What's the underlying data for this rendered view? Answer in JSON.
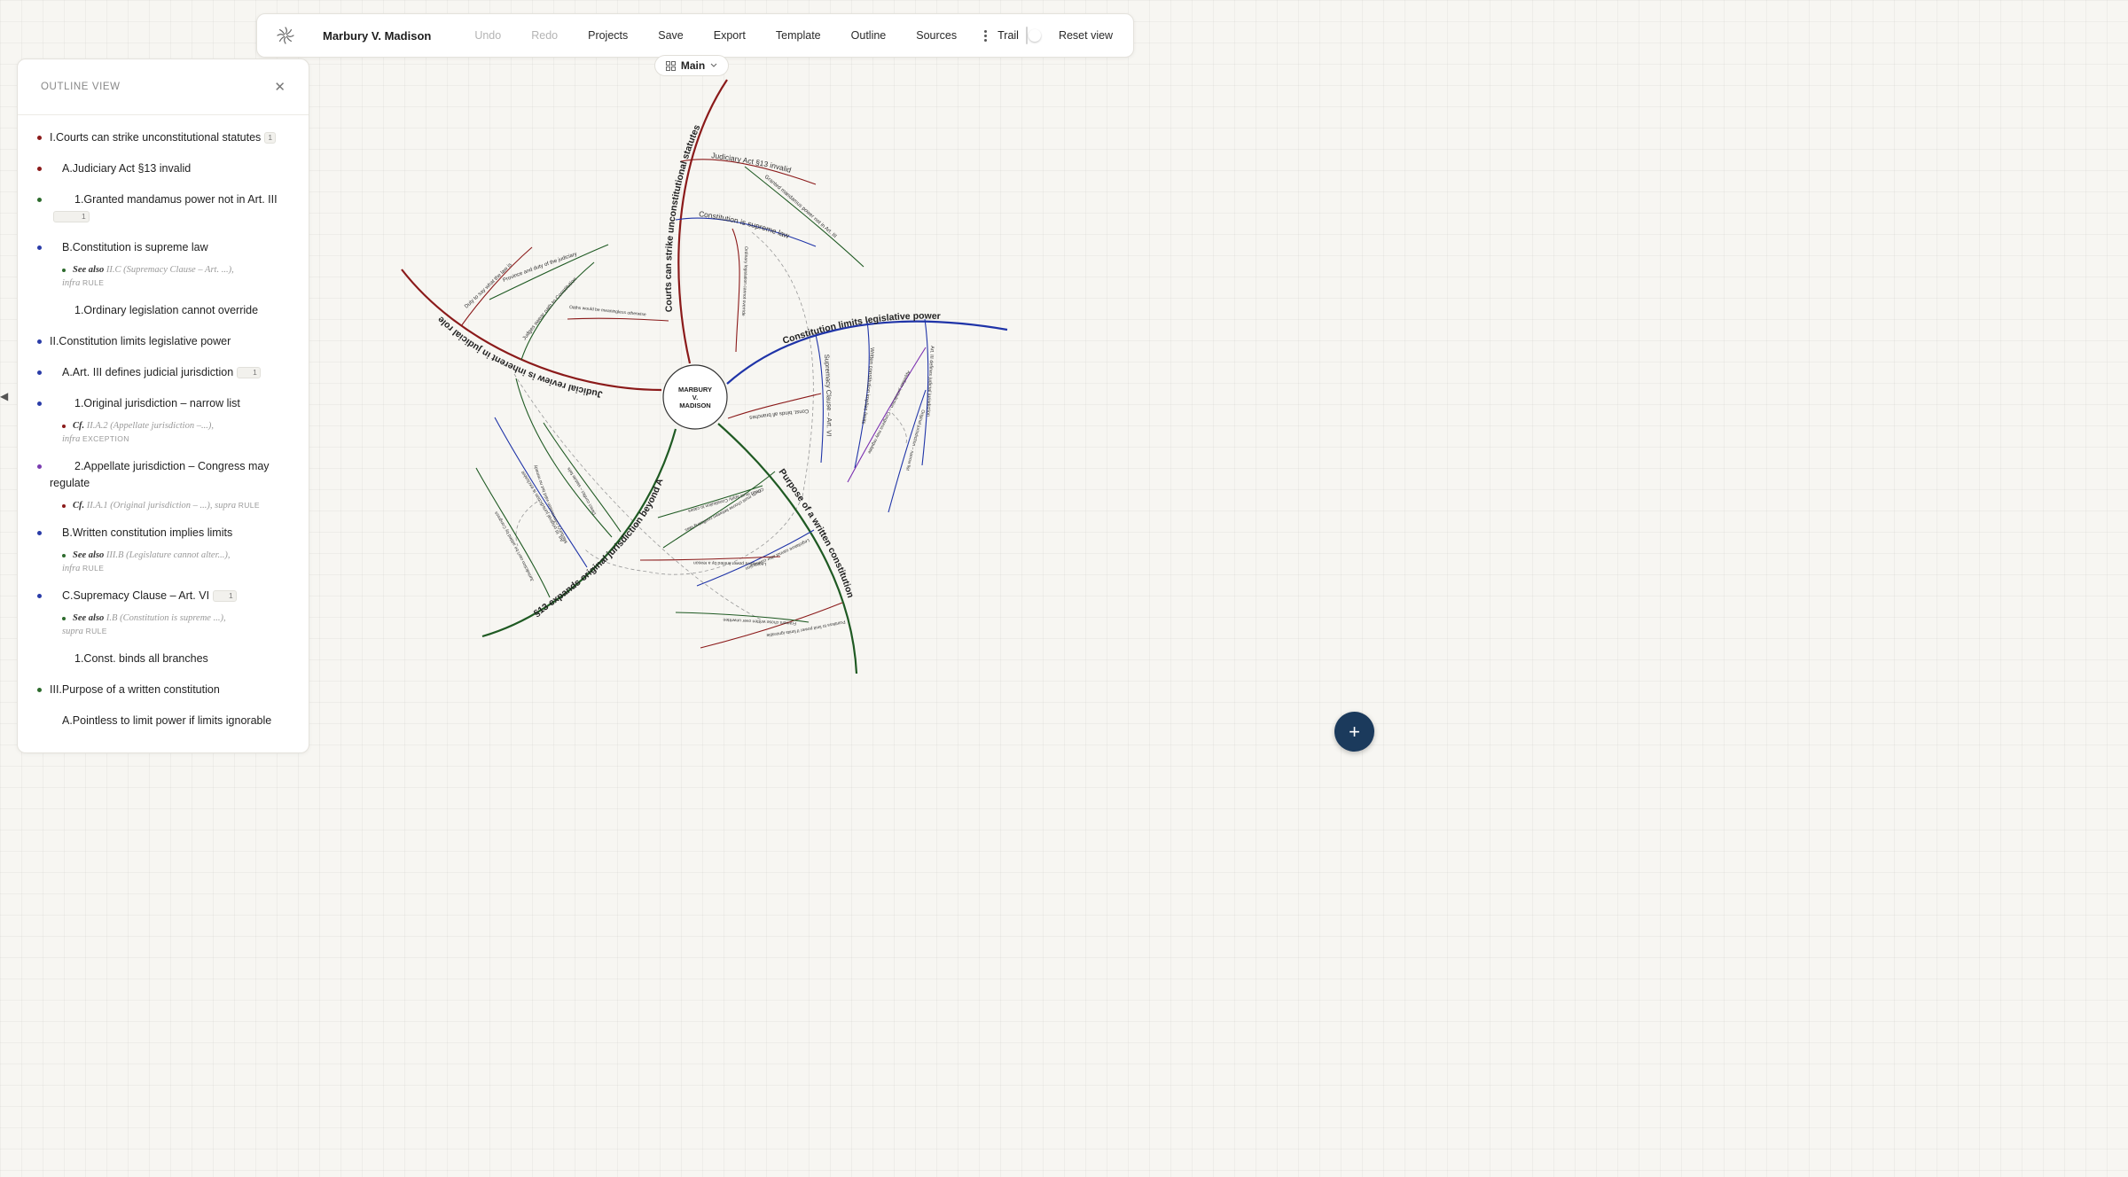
{
  "toolbar": {
    "title": "Marbury V. Madison",
    "undo": "Undo",
    "redo": "Redo",
    "projects": "Projects",
    "save": "Save",
    "export": "Export",
    "template": "Template",
    "outline": "Outline",
    "sources": "Sources",
    "trail_label": "Trail",
    "trail_on": false,
    "reset": "Reset view"
  },
  "view_selector": {
    "label": "Main"
  },
  "outline": {
    "title": "OUTLINE VIEW",
    "items": [
      {
        "text": "I.Courts can strike unconstitutional statutes",
        "badge": "1",
        "color": "#8b1a1a"
      },
      {
        "text": "A.Judiciary Act §13 invalid",
        "color": "#8b1a1a"
      },
      {
        "text": "1.Granted mandamus power not in Art. III",
        "badge": "1",
        "color": "#2d6b2d"
      },
      {
        "text": "B.Constitution is supreme law",
        "color": "#2a3ca8"
      },
      {
        "sig": "See also",
        "ref": "II.C",
        "desc": "(Supremacy Clause – Art. ...),",
        "where": "infra",
        "kind": "RULE",
        "color": "#2d6b2d"
      },
      {
        "text": "1.Ordinary legislation cannot override"
      },
      {
        "text": "II.Constitution limits legislative power",
        "color": "#2a3ca8"
      },
      {
        "text": "A.Art.  III defines judicial jurisdiction",
        "badge": "1",
        "color": "#2a3ca8"
      },
      {
        "text": "1.Original jurisdiction – narrow list",
        "color": "#2a3ca8"
      },
      {
        "sig": "Cf.",
        "ref": "II.A.2",
        "desc": "(Appellate jurisdiction –...),",
        "where": "infra",
        "kind": "EXCEPTION",
        "color": "#8b1a1a"
      },
      {
        "text": "2.Appellate jurisdiction – Congress may regulate",
        "color": "#7a3cb0"
      },
      {
        "sig": "Cf.",
        "ref": "II.A.1",
        "desc": "(Original jurisdiction – ...),",
        "where": "supra",
        "kind": "RULE",
        "color": "#8b1a1a"
      },
      {
        "text": "B.Written constitution implies limits",
        "color": "#2a3ca8"
      },
      {
        "sig": "See also",
        "ref": "III.B",
        "desc": "(Legislature cannot alter...),",
        "where": "infra",
        "kind": "RULE",
        "color": "#2d6b2d"
      },
      {
        "text": "C.Supremacy Clause – Art. VI",
        "badge": "1",
        "color": "#2a3ca8"
      },
      {
        "sig": "See also",
        "ref": "I.B",
        "desc": "(Constitution is supreme ...),",
        "where": "supra",
        "kind": "RULE",
        "color": "#2d6b2d"
      },
      {
        "text": "1.Const. binds all branches"
      },
      {
        "text": "III.Purpose of a written constitution",
        "color": "#2d6b2d"
      },
      {
        "text": "A.Pointless to limit power if limits ignorable"
      }
    ]
  },
  "map": {
    "center": [
      "MARBURY",
      "V.",
      "MADISON"
    ],
    "colors": {
      "red": "#8b1a1a",
      "blue": "#1f34a8",
      "green": "#1f5a23",
      "purple": "#7a2fb0",
      "gray": "#888888"
    },
    "branches": [
      {
        "label": "Courts can strike unconstitutional statutes",
        "color": "red",
        "children": [
          "Judiciary Act §13 invalid",
          "Granted mandamus power not in Art. III",
          "Constitution is supreme law",
          "Ordinary legislation cannot override"
        ]
      },
      {
        "label": "Constitution limits legislative power",
        "color": "blue",
        "children": [
          "Supremacy Clause – Art. VI",
          "Const. binds all branches",
          "Written constitution implies limits",
          "Art. III defines judicial jurisdiction",
          "Appellate jurisdiction – Congress may regulate",
          "Original jurisdiction – narrow list"
        ]
      },
      {
        "label": "Purpose of a written constitution",
        "color": "green",
        "children": [
          "Pointless to limit power if limits ignorable",
          "Framers chose written over unwritten",
          "Legislature cannot alter constitution",
          "Legislative power limited by a reason",
          "Courts must choose between conflicting laws",
          "Court must apply Constitution to cases"
        ]
      },
      {
        "label": "§13 expands original jurisdiction beyond Art. III",
        "color": "green",
        "children": [
          "Jurisdiction can't be added by Congress",
          "Art. III original jurisdiction is exclusive",
          "Direct conflict – statute fails",
          "Writ issues – appellate jurisdiction",
          "Marbury's commission valid but no remedy"
        ]
      },
      {
        "label": "Judicial review is inherent in judicial role",
        "color": "red",
        "children": [
          "Duty to say what the law is",
          "Province and duty of the judiciary",
          "Judges swear oath to Constitution",
          "Oaths would be meaningless otherwise"
        ]
      }
    ]
  },
  "fab": {
    "label": "+"
  },
  "side_arrow": "◀"
}
